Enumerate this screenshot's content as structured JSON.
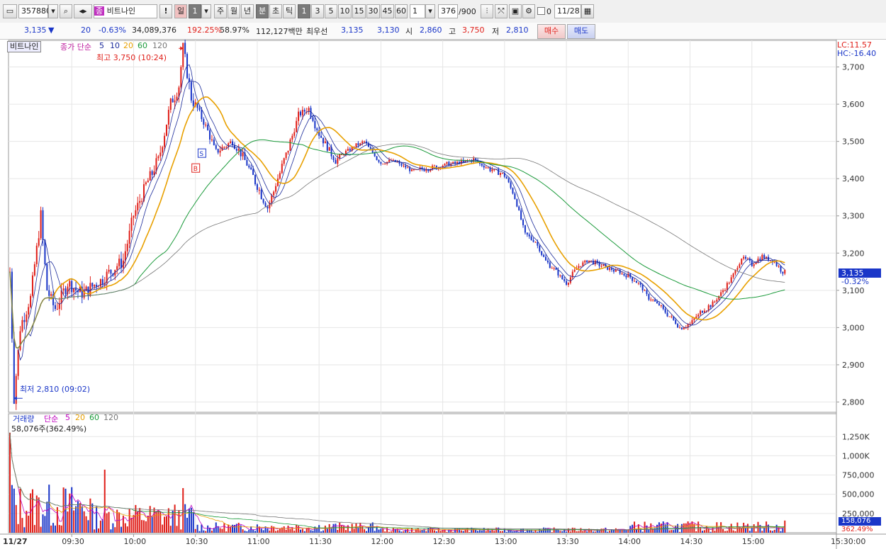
{
  "toolbar": {
    "code": "357880",
    "name": "비트나인",
    "name_badge": "종",
    "alert_btn": "!",
    "period_selected": "일",
    "period_count": "1",
    "periods": [
      "주",
      "월",
      "년"
    ],
    "minute_label": "분",
    "sec_label": "초",
    "tick_label": "틱",
    "intervals": [
      "1",
      "3",
      "5",
      "10",
      "15",
      "30",
      "45",
      "60"
    ],
    "interval_value": "1",
    "bar_count": "376",
    "bar_total": "/900",
    "checkbox_label": "0",
    "date": "11/28"
  },
  "status": {
    "price": "3,135",
    "change_arrow": "▼",
    "change": "20",
    "change_pct": "-0.63%",
    "volume": "34,089,376",
    "vol_ratio": "192.25%",
    "turnover": "58.97%",
    "amount": "112,127백만",
    "best_label": "최우선",
    "best_ask": "3,135",
    "best_bid": "3,130",
    "open_label": "시",
    "open": "2,860",
    "high_label": "고",
    "high": "3,750",
    "low_label": "저",
    "low": "2,810",
    "buy": "매수",
    "sell": "매도"
  },
  "price_panel": {
    "stock_label": "비트나인",
    "legend_title": "종가 단순",
    "ma": [
      {
        "period": "5",
        "color": "#1a2a9a"
      },
      {
        "period": "10",
        "color": "#1a2a9a"
      },
      {
        "period": "20",
        "color": "#e8a000"
      },
      {
        "period": "60",
        "color": "#1a9a3a"
      },
      {
        "period": "120",
        "color": "#777777"
      }
    ],
    "high_note": "최고 3,750 (10:24)",
    "low_note": "최저 2,810 (09:02)",
    "lc": "LC:11.57",
    "hc": "HC:-16.40",
    "current_tag": "3,135",
    "current_pct": "-0.32%",
    "y_ticks": [
      "3,700",
      "3,600",
      "3,500",
      "3,400",
      "3,300",
      "3,200",
      "3,100",
      "3,000",
      "2,900",
      "2,800"
    ]
  },
  "volume_panel": {
    "legend_title": "거래량",
    "legend_ma": "단순",
    "ma": [
      {
        "period": "5",
        "color": "#c000c0"
      },
      {
        "period": "20",
        "color": "#e8a000"
      },
      {
        "period": "60",
        "color": "#1a9a3a"
      },
      {
        "period": "120",
        "color": "#777777"
      }
    ],
    "sub_label": "58,076주(362.49%)",
    "y_ticks": [
      "1,250K",
      "1,000K",
      "750,000",
      "500,000",
      "250,000"
    ],
    "current_tag": "158,076",
    "current_pct": "362.49%"
  },
  "x_axis": {
    "ticks": [
      "11/27",
      "09:30",
      "10:00",
      "10:30",
      "11:00",
      "11:30",
      "12:00",
      "12:30",
      "13:00",
      "13:30",
      "14:00",
      "14:30",
      "15:00",
      "15:30:00"
    ]
  },
  "colors": {
    "up": "#e0201a",
    "down": "#1a36c8",
    "grid": "#e6e6e6"
  },
  "chart_data": {
    "type": "candlestick",
    "x_range": [
      "09:00",
      "15:30"
    ],
    "price_ylim": [
      2780,
      3760
    ],
    "price_points": [
      [
        "09:00",
        3150
      ],
      [
        "09:02",
        2810
      ],
      [
        "09:05",
        3000
      ],
      [
        "09:10",
        3080
      ],
      [
        "09:15",
        3300
      ],
      [
        "09:18",
        3100
      ],
      [
        "09:22",
        3050
      ],
      [
        "09:28",
        3120
      ],
      [
        "09:35",
        3090
      ],
      [
        "09:45",
        3130
      ],
      [
        "09:55",
        3180
      ],
      [
        "10:00",
        3300
      ],
      [
        "10:05",
        3370
      ],
      [
        "10:12",
        3450
      ],
      [
        "10:18",
        3600
      ],
      [
        "10:22",
        3650
      ],
      [
        "10:24",
        3750
      ],
      [
        "10:28",
        3620
      ],
      [
        "10:35",
        3540
      ],
      [
        "10:40",
        3470
      ],
      [
        "10:48",
        3500
      ],
      [
        "10:55",
        3440
      ],
      [
        "11:00",
        3380
      ],
      [
        "11:05",
        3320
      ],
      [
        "11:10",
        3400
      ],
      [
        "11:15",
        3480
      ],
      [
        "11:20",
        3570
      ],
      [
        "11:25",
        3590
      ],
      [
        "11:30",
        3520
      ],
      [
        "11:38",
        3450
      ],
      [
        "11:45",
        3480
      ],
      [
        "11:52",
        3500
      ],
      [
        "12:00",
        3440
      ],
      [
        "12:05",
        3450
      ],
      [
        "12:15",
        3420
      ],
      [
        "12:25",
        3430
      ],
      [
        "12:35",
        3440
      ],
      [
        "12:45",
        3450
      ],
      [
        "12:55",
        3420
      ],
      [
        "13:00",
        3410
      ],
      [
        "13:05",
        3350
      ],
      [
        "13:10",
        3250
      ],
      [
        "13:15",
        3230
      ],
      [
        "13:20",
        3180
      ],
      [
        "13:25",
        3150
      ],
      [
        "13:30",
        3120
      ],
      [
        "13:35",
        3160
      ],
      [
        "13:40",
        3180
      ],
      [
        "13:50",
        3160
      ],
      [
        "14:00",
        3140
      ],
      [
        "14:05",
        3120
      ],
      [
        "14:10",
        3080
      ],
      [
        "14:15",
        3060
      ],
      [
        "14:20",
        3030
      ],
      [
        "14:25",
        3000
      ],
      [
        "14:30",
        3010
      ],
      [
        "14:35",
        3040
      ],
      [
        "14:40",
        3060
      ],
      [
        "14:45",
        3090
      ],
      [
        "14:50",
        3130
      ],
      [
        "14:55",
        3190
      ],
      [
        "15:00",
        3170
      ],
      [
        "15:05",
        3190
      ],
      [
        "15:10",
        3180
      ],
      [
        "15:15",
        3150
      ],
      [
        "15:20",
        3135
      ]
    ],
    "volume_ylim": [
      0,
      1400000
    ],
    "volume_max_label": "1,250K",
    "last_volume": 158076
  }
}
